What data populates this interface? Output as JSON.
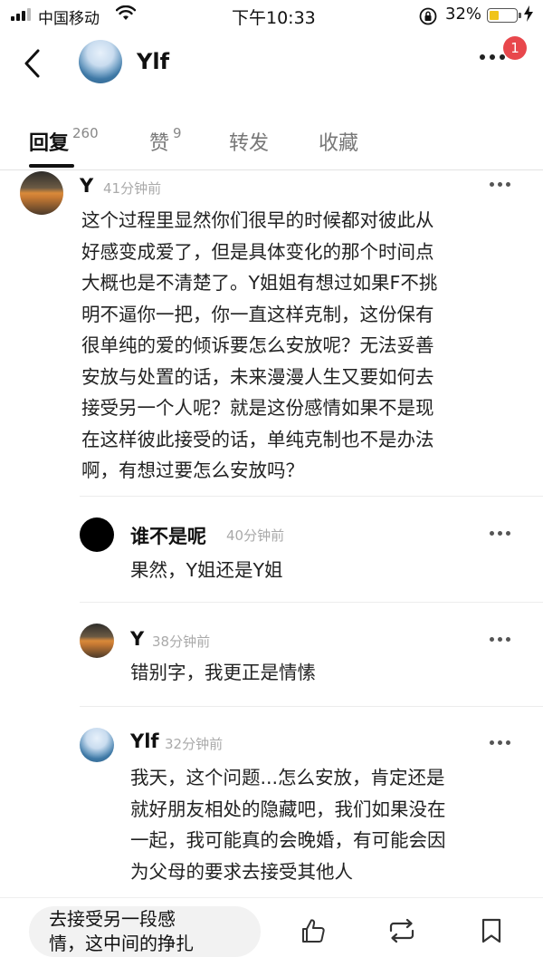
{
  "status_bar": {
    "carrier": "中国移动",
    "time": "下午10:33",
    "battery_percent": "32%",
    "battery_level": 0.32
  },
  "header": {
    "title": "Ylf",
    "notification_count": "1"
  },
  "tabs": [
    {
      "label": "回复",
      "count": "260",
      "active": true
    },
    {
      "label": "赞",
      "count": "9",
      "active": false
    },
    {
      "label": "转发",
      "count": "",
      "active": false
    },
    {
      "label": "收藏",
      "count": "",
      "active": false
    }
  ],
  "main_comment": {
    "author": "Y",
    "time": "41分钟前",
    "lines": [
      "这个过程里显然你们很早的时候都对彼此从",
      "好感变成爱了，但是具体变化的那个时间点",
      "大概也是不清楚了。Y姐姐有想过如果F不挑",
      "明不逼你一把，你一直这样克制，这份保有",
      "很单纯的爱的倾诉要怎么安放呢？无法妥善",
      "安放与处置的话，未来漫漫人生又要如何去",
      "接受另一个人呢？就是这份感情如果不是现",
      "在这样彼此接受的话，单纯克制也不是办法",
      "啊，有想过要怎么安放吗？"
    ]
  },
  "replies": [
    {
      "author": "谁不是呢",
      "time": "40分钟前",
      "lines": [
        "果然，Y姐还是Y姐"
      ]
    },
    {
      "author": "Y",
      "time": "38分钟前",
      "lines": [
        "错别字，我更正是情愫"
      ]
    },
    {
      "author": "Ylf",
      "time": "32分钟前",
      "lines": [
        "我天，这个问题...怎么安放，肯定还是",
        "就好朋友相处的隐藏吧，我们如果没在",
        "一起，我可能真的会晚婚，有可能会因",
        "为父母的要求去接受其他人"
      ]
    }
  ],
  "bottom_bar": {
    "reply_lines": [
      "去接受另一段感",
      "情，这中间的挣扎"
    ],
    "icons": [
      "like-icon",
      "repost-icon",
      "bookmark-icon"
    ]
  }
}
